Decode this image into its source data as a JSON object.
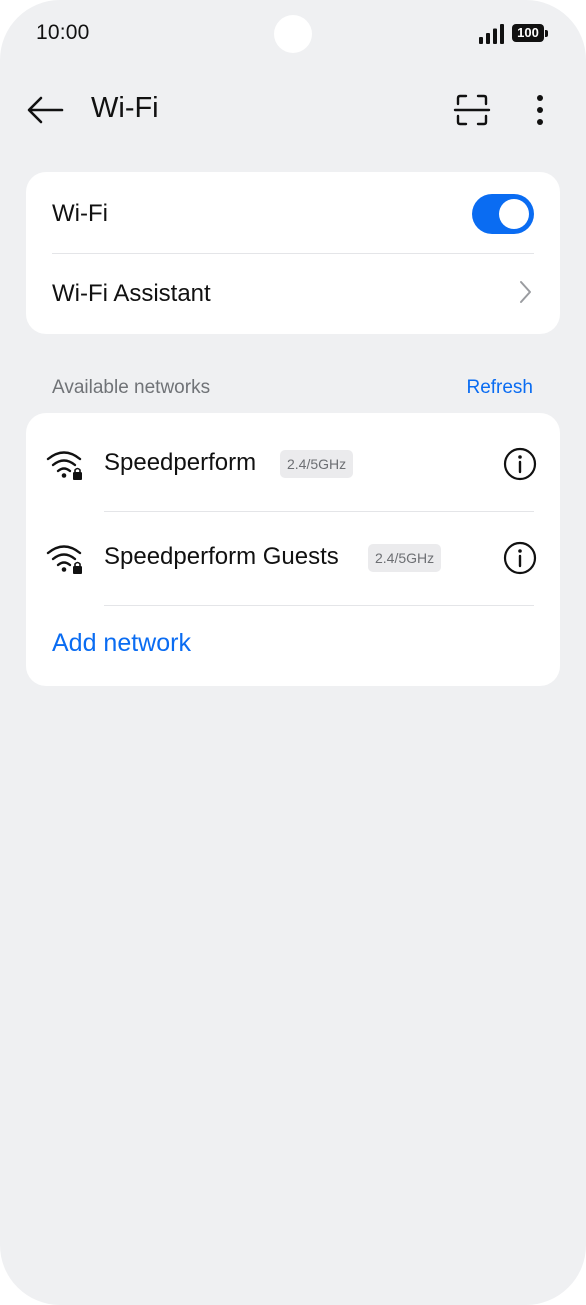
{
  "status_bar": {
    "time": "10:00",
    "battery": "100",
    "signal_icon": "signal-bars-icon"
  },
  "header": {
    "title": "Wi-Fi",
    "back_icon": "arrow-left-icon",
    "scan_icon": "scan-frame-icon",
    "more_icon": "more-vertical-icon"
  },
  "wifi_card": {
    "wifi_label": "Wi-Fi",
    "wifi_enabled": true,
    "assistant_label": "Wi-Fi Assistant"
  },
  "networks_section": {
    "label": "Available networks",
    "refresh_label": "Refresh"
  },
  "networks": [
    {
      "name": "Speedperform",
      "band": "2.4/5GHz",
      "secured": true
    },
    {
      "name": "Speedperform Guests",
      "band": "2.4/5GHz",
      "secured": true
    }
  ],
  "add_network_label": "Add network",
  "colors": {
    "accent": "#0a6cf2",
    "background": "#eff0f2",
    "card": "#ffffff"
  }
}
